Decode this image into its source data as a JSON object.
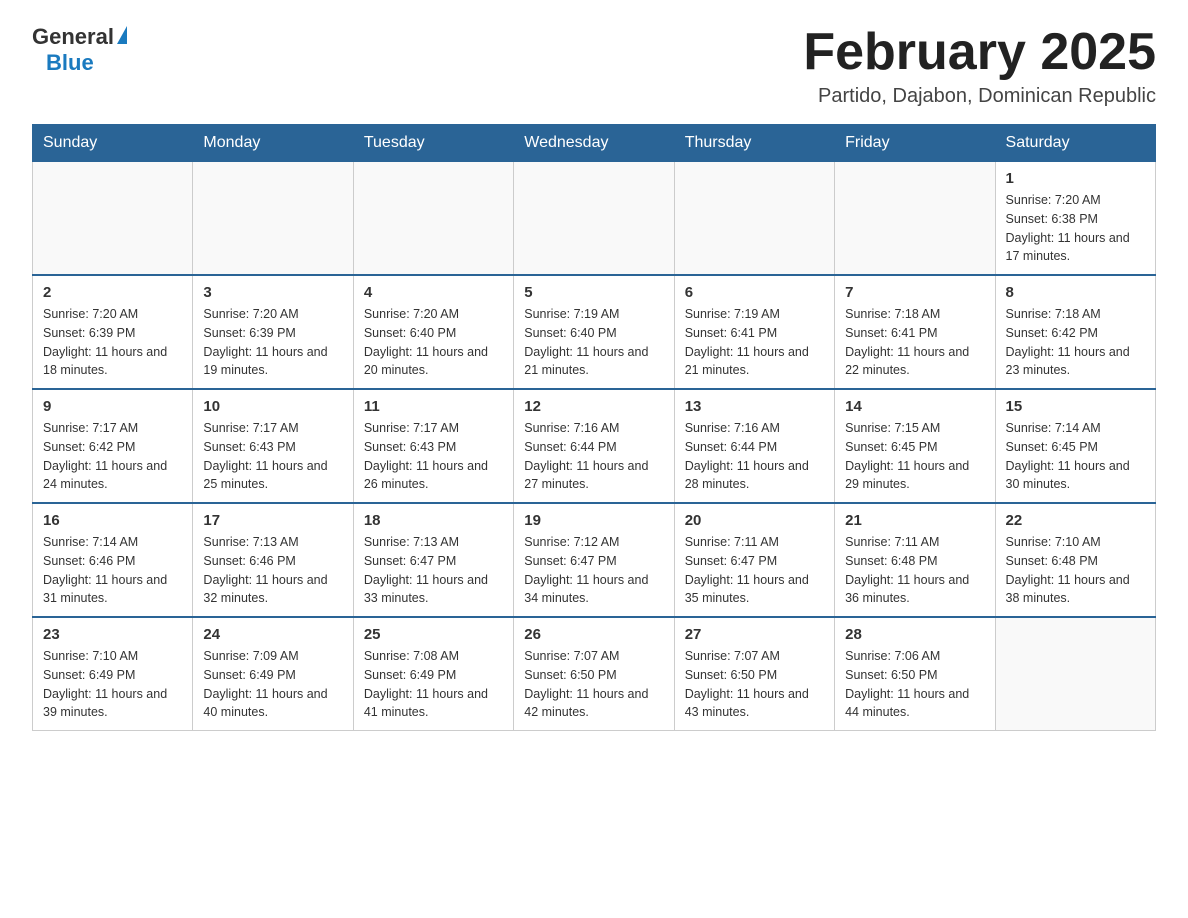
{
  "header": {
    "logo_general": "General",
    "logo_blue": "Blue",
    "title": "February 2025",
    "location": "Partido, Dajabon, Dominican Republic"
  },
  "days_of_week": [
    "Sunday",
    "Monday",
    "Tuesday",
    "Wednesday",
    "Thursday",
    "Friday",
    "Saturday"
  ],
  "weeks": [
    [
      {
        "day": "",
        "info": ""
      },
      {
        "day": "",
        "info": ""
      },
      {
        "day": "",
        "info": ""
      },
      {
        "day": "",
        "info": ""
      },
      {
        "day": "",
        "info": ""
      },
      {
        "day": "",
        "info": ""
      },
      {
        "day": "1",
        "info": "Sunrise: 7:20 AM\nSunset: 6:38 PM\nDaylight: 11 hours and 17 minutes."
      }
    ],
    [
      {
        "day": "2",
        "info": "Sunrise: 7:20 AM\nSunset: 6:39 PM\nDaylight: 11 hours and 18 minutes."
      },
      {
        "day": "3",
        "info": "Sunrise: 7:20 AM\nSunset: 6:39 PM\nDaylight: 11 hours and 19 minutes."
      },
      {
        "day": "4",
        "info": "Sunrise: 7:20 AM\nSunset: 6:40 PM\nDaylight: 11 hours and 20 minutes."
      },
      {
        "day": "5",
        "info": "Sunrise: 7:19 AM\nSunset: 6:40 PM\nDaylight: 11 hours and 21 minutes."
      },
      {
        "day": "6",
        "info": "Sunrise: 7:19 AM\nSunset: 6:41 PM\nDaylight: 11 hours and 21 minutes."
      },
      {
        "day": "7",
        "info": "Sunrise: 7:18 AM\nSunset: 6:41 PM\nDaylight: 11 hours and 22 minutes."
      },
      {
        "day": "8",
        "info": "Sunrise: 7:18 AM\nSunset: 6:42 PM\nDaylight: 11 hours and 23 minutes."
      }
    ],
    [
      {
        "day": "9",
        "info": "Sunrise: 7:17 AM\nSunset: 6:42 PM\nDaylight: 11 hours and 24 minutes."
      },
      {
        "day": "10",
        "info": "Sunrise: 7:17 AM\nSunset: 6:43 PM\nDaylight: 11 hours and 25 minutes."
      },
      {
        "day": "11",
        "info": "Sunrise: 7:17 AM\nSunset: 6:43 PM\nDaylight: 11 hours and 26 minutes."
      },
      {
        "day": "12",
        "info": "Sunrise: 7:16 AM\nSunset: 6:44 PM\nDaylight: 11 hours and 27 minutes."
      },
      {
        "day": "13",
        "info": "Sunrise: 7:16 AM\nSunset: 6:44 PM\nDaylight: 11 hours and 28 minutes."
      },
      {
        "day": "14",
        "info": "Sunrise: 7:15 AM\nSunset: 6:45 PM\nDaylight: 11 hours and 29 minutes."
      },
      {
        "day": "15",
        "info": "Sunrise: 7:14 AM\nSunset: 6:45 PM\nDaylight: 11 hours and 30 minutes."
      }
    ],
    [
      {
        "day": "16",
        "info": "Sunrise: 7:14 AM\nSunset: 6:46 PM\nDaylight: 11 hours and 31 minutes."
      },
      {
        "day": "17",
        "info": "Sunrise: 7:13 AM\nSunset: 6:46 PM\nDaylight: 11 hours and 32 minutes."
      },
      {
        "day": "18",
        "info": "Sunrise: 7:13 AM\nSunset: 6:47 PM\nDaylight: 11 hours and 33 minutes."
      },
      {
        "day": "19",
        "info": "Sunrise: 7:12 AM\nSunset: 6:47 PM\nDaylight: 11 hours and 34 minutes."
      },
      {
        "day": "20",
        "info": "Sunrise: 7:11 AM\nSunset: 6:47 PM\nDaylight: 11 hours and 35 minutes."
      },
      {
        "day": "21",
        "info": "Sunrise: 7:11 AM\nSunset: 6:48 PM\nDaylight: 11 hours and 36 minutes."
      },
      {
        "day": "22",
        "info": "Sunrise: 7:10 AM\nSunset: 6:48 PM\nDaylight: 11 hours and 38 minutes."
      }
    ],
    [
      {
        "day": "23",
        "info": "Sunrise: 7:10 AM\nSunset: 6:49 PM\nDaylight: 11 hours and 39 minutes."
      },
      {
        "day": "24",
        "info": "Sunrise: 7:09 AM\nSunset: 6:49 PM\nDaylight: 11 hours and 40 minutes."
      },
      {
        "day": "25",
        "info": "Sunrise: 7:08 AM\nSunset: 6:49 PM\nDaylight: 11 hours and 41 minutes."
      },
      {
        "day": "26",
        "info": "Sunrise: 7:07 AM\nSunset: 6:50 PM\nDaylight: 11 hours and 42 minutes."
      },
      {
        "day": "27",
        "info": "Sunrise: 7:07 AM\nSunset: 6:50 PM\nDaylight: 11 hours and 43 minutes."
      },
      {
        "day": "28",
        "info": "Sunrise: 7:06 AM\nSunset: 6:50 PM\nDaylight: 11 hours and 44 minutes."
      },
      {
        "day": "",
        "info": ""
      }
    ]
  ]
}
